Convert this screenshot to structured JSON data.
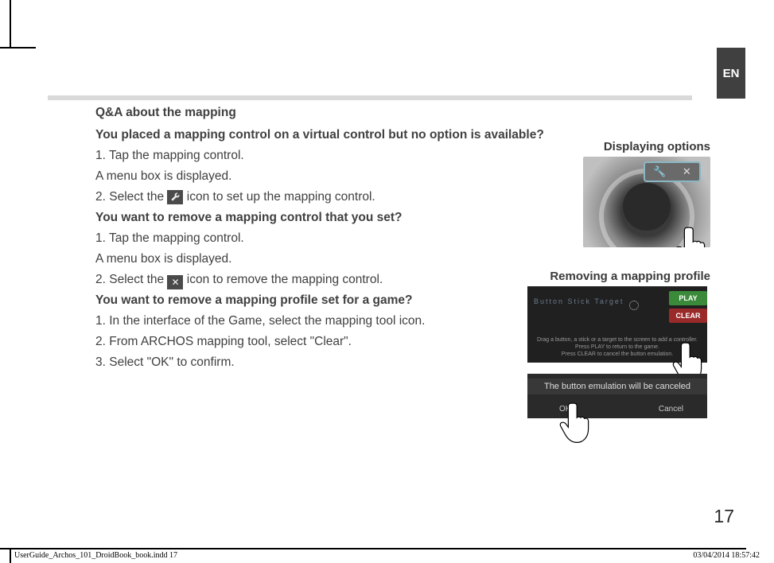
{
  "langTab": "EN",
  "pageNumber": "17",
  "footer": {
    "left": "UserGuide_Archos_101_DroidBook_book.indd   17",
    "right": "03/04/2014   18:57:42"
  },
  "qa": {
    "heading": "Q&A about the mapping",
    "q1": "You placed a mapping control on a virtual control but no option is available?",
    "q1_step1": "1. Tap the mapping control.",
    "q1_step1b": "A menu box is displayed.",
    "q1_step2_pre": "2. Select the ",
    "q1_step2_post": " icon to set up the mapping control.",
    "q2": "You want to remove a mapping control that you set?",
    "q2_step1": "1. Tap the mapping control.",
    "q2_step1b": "A menu box is displayed.",
    "q2_step2_pre": "2. Select the ",
    "q2_step2_post": " icon to remove the mapping control.",
    "q3": "You want to remove a mapping profile set for a game?",
    "q3_step1": "1. In the interface of the Game, select the mapping tool icon.",
    "q3_step2": "2. From ARCHOS mapping tool, select \"Clear\".",
    "q3_step3": "3. Select \"OK\" to confirm."
  },
  "figures": {
    "cap1": "Displaying options",
    "cap2": "Removing a mapping profile",
    "fig2_play": "PLAY",
    "fig2_clear": "CLEAR",
    "fig2_row": "Button      Stick      Target",
    "fig2_hint1": "Drag a button, a stick or a target to the screen to add a controller.",
    "fig2_hint2": "Press PLAY to return to the game.",
    "fig2_hint3": "Press CLEAR to cancel the button emulation.",
    "fig3_msg": "The button emulation will be canceled",
    "fig3_ok": "OK",
    "fig3_cancel": "Cancel"
  },
  "icons": {
    "wrench": "wrench-icon",
    "close": "close-icon"
  }
}
